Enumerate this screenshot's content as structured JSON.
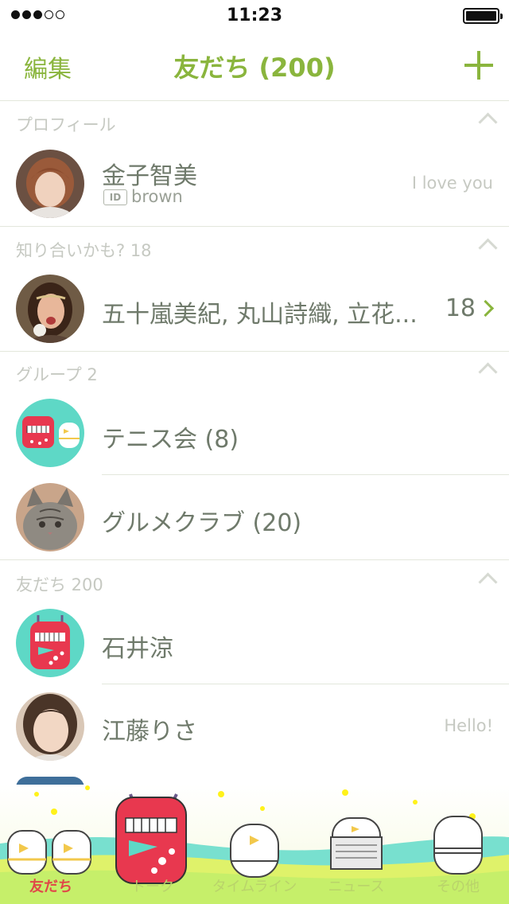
{
  "status_bar": {
    "time": "11:23"
  },
  "nav": {
    "edit_label": "編集",
    "title": "友だち (200)"
  },
  "sections": {
    "profile": "プロフィール",
    "suggest": "知り合いかも? 18",
    "groups": "グループ 2",
    "friends": "友だち 200"
  },
  "profile": {
    "name": "金子智美",
    "id_badge": "ID",
    "id_value": "brown",
    "status": "I love you"
  },
  "suggest": {
    "names": "五十嵐美紀, 丸山詩織, 立花...",
    "count": "18"
  },
  "groups": [
    {
      "name": "テニス会 (8)"
    },
    {
      "name": "グルメクラブ (20)"
    }
  ],
  "friends": [
    {
      "name": "石井涼",
      "status": ""
    },
    {
      "name": "江藤りさ",
      "status": "Hello!"
    }
  ],
  "tabs": [
    {
      "label": "友だち",
      "icon": "friends-tab-icon"
    },
    {
      "label": "トーク",
      "icon": "talk-tab-icon"
    },
    {
      "label": "タイムライン",
      "icon": "timeline-tab-icon"
    },
    {
      "label": "ニュース",
      "icon": "news-tab-icon"
    },
    {
      "label": "その他",
      "icon": "more-tab-icon"
    }
  ],
  "colors": {
    "accent": "#8ab53d",
    "active_tab": "#e04848",
    "text": "#6f7a6b",
    "subtle": "#c6c9c2",
    "mascot_red": "#e8384f",
    "mascot_teal": "#5ed8c6"
  }
}
